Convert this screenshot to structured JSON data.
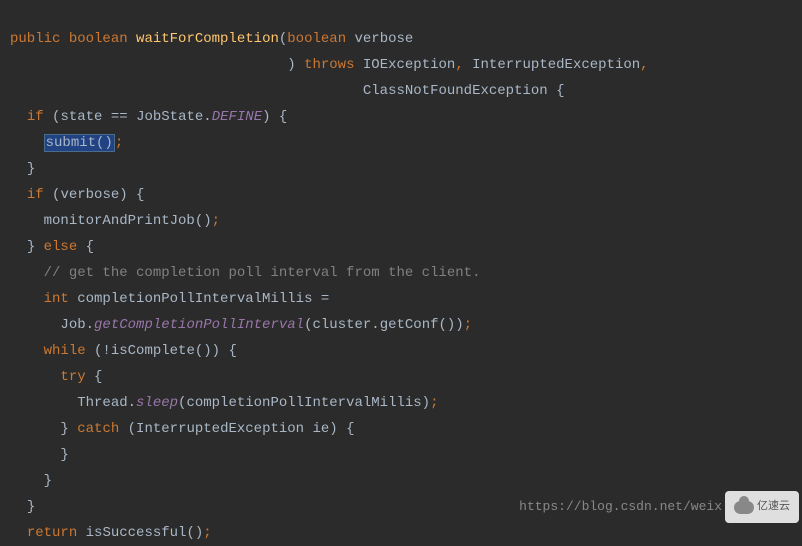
{
  "code": {
    "l1_public": "public",
    "l1_boolean": "boolean",
    "l1_method": "waitForCompletion",
    "l1_param_boolean": "boolean",
    "l1_param_name": " verbose",
    "l2_throws": "throws",
    "l2_ex1": "IOException",
    "l2_ex2": "InterruptedException",
    "l3_ex3": "ClassNotFoundException",
    "l4_if": "if",
    "l4_state": "state",
    "l4_eq": " == ",
    "l4_jobstate": "JobState.",
    "l4_define": "DEFINE",
    "l5_submit": "submit()",
    "l7_if": "if",
    "l7_verbose": "verbose",
    "l8_monitor": "monitorAndPrintJob()",
    "l9_else": "else",
    "l10_comment": "// get the completion poll interval from the client.",
    "l11_int": "int",
    "l11_var": " completionPollIntervalMillis =",
    "l12_job": "Job.",
    "l12_getinterval": "getCompletionPollInterval",
    "l12_cluster": "cluster",
    "l12_getconf": ".getConf())",
    "l13_while": "while",
    "l13_iscomplete": "(!isComplete()) {",
    "l14_try": "try",
    "l15_thread": "Thread.",
    "l15_sleep": "sleep",
    "l15_arg": "(completionPollIntervalMillis)",
    "l16_catch": "catch",
    "l16_exc": "(InterruptedException ie) {",
    "l20_return": "return",
    "l20_success": " isSuccessful()"
  },
  "watermark": {
    "url": "https://blog.csdn.net/weix",
    "brand": "亿速云"
  }
}
